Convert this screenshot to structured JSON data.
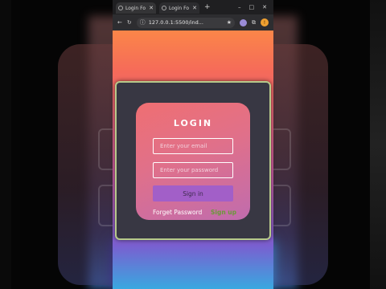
{
  "browser": {
    "tabs": [
      {
        "label": "Login Fo",
        "active": true
      },
      {
        "label": "Login Fo",
        "active": false
      }
    ],
    "new_tab_symbol": "+",
    "window_controls": [
      "–",
      "□",
      "✕"
    ],
    "url": "127.0.0.1:5500/ind...",
    "profile_initial": "!"
  },
  "login": {
    "title": "LOGIN",
    "email_placeholder": "Enter your email",
    "password_placeholder": "Enter your password",
    "signin_label": "Sign in",
    "forget_label": "Forget Password",
    "signup_label": "Sign up"
  },
  "colors": {
    "card_gradient_start": "#ef6f72",
    "card_gradient_end": "#c06cae",
    "button": "#a25fc8",
    "frame_border": "#b7c98a",
    "signup_link": "#6a9a3a"
  }
}
